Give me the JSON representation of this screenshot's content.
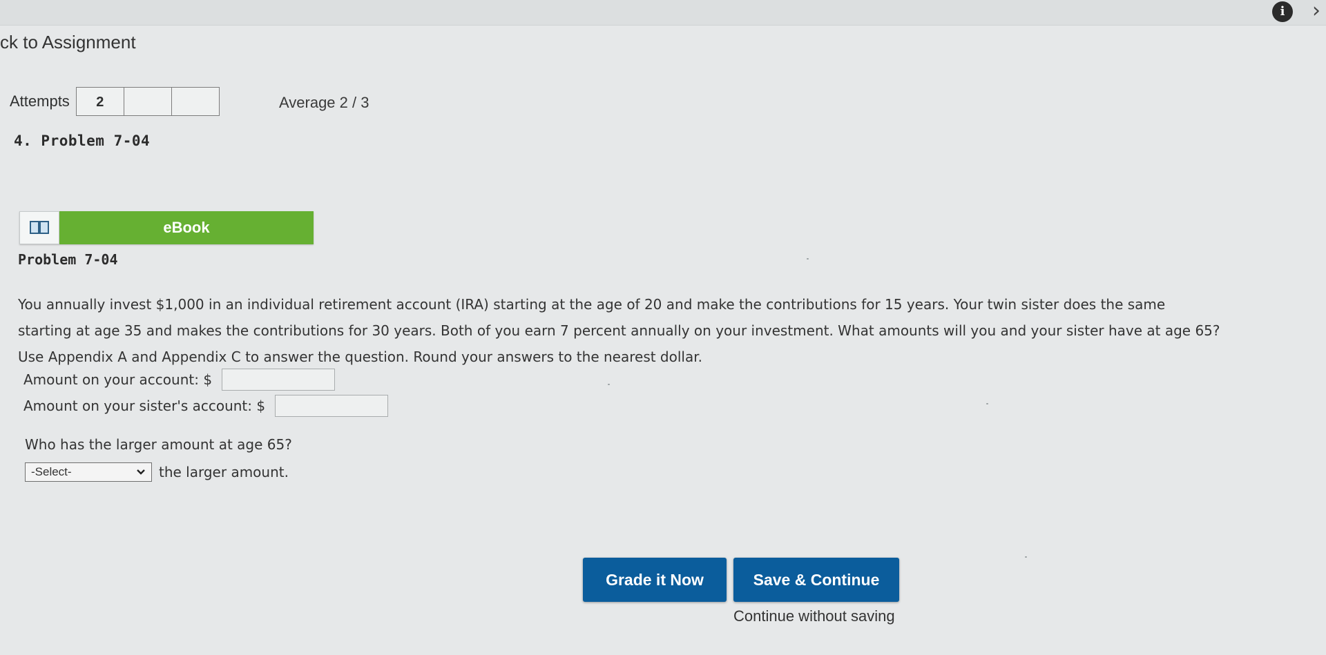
{
  "nav": {
    "back_label": "ck to Assignment"
  },
  "attempts": {
    "label": "Attempts",
    "boxes": [
      "2",
      "",
      ""
    ]
  },
  "average": {
    "label": "Average 2 / 3"
  },
  "problem": {
    "heading": "4. Problem 7-04",
    "title": "Problem 7-04",
    "ebook_label": "eBook",
    "text_lines": [
      "You annually invest $1,000 in an individual retirement account (IRA) starting at the age of 20 and make the contributions for 15 years. Your twin sister does the same",
      "starting at age 35 and makes the contributions for 30 years. Both of you earn 7 percent annually on your investment. What amounts will you and your sister have at age 65?",
      "Use Appendix A and Appendix C to answer the question. Round your answers to the nearest dollar."
    ]
  },
  "answers": {
    "your_account_label": "Amount on your account: $",
    "your_account_value": "",
    "sister_account_label": "Amount on your sister's account: $",
    "sister_account_value": ""
  },
  "question2": {
    "prompt": "Who has the larger amount at age 65?",
    "select_value": "-Select-",
    "suffix": "the larger amount."
  },
  "buttons": {
    "grade": "Grade it Now",
    "save": "Save & Continue",
    "continue_without_saving": "Continue without saving"
  },
  "icons": {
    "info": "info-icon",
    "close": "close-icon",
    "ebook": "book-icon",
    "dropdown": "chevron-down-icon"
  },
  "colors": {
    "ebook_green": "#66b032",
    "button_blue": "#0b5d9c"
  }
}
